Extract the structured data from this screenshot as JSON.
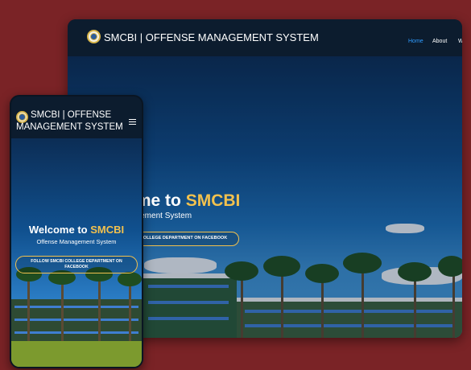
{
  "desktop": {
    "brand": "SMCBI | OFFENSE MANAGEMENT SYSTEM",
    "nav": [
      {
        "label": "Home",
        "active": true
      },
      {
        "label": "About",
        "active": false
      },
      {
        "label": "W",
        "active": false
      }
    ],
    "hero": {
      "welcome_prefix": "ome to",
      "welcome_highlight": "SMCBI",
      "subtitle": "agement System",
      "cta": "COLLEGE DEPARTMENT ON FACEBOOK"
    }
  },
  "phone": {
    "brand_line1": "SMCBI | OFFENSE",
    "brand_line2": "MANAGEMENT SYSTEM",
    "menu_icon": "hamburger-icon",
    "hero": {
      "welcome_prefix": "Welcome to",
      "welcome_highlight": "SMCBI",
      "subtitle": "Offense Management System",
      "cta_line1": "FOLLOW SMCBI COLLEGE DEPARTMENT ON",
      "cta_line2": "FACEBOOK"
    }
  },
  "colors": {
    "background": "#7a2326",
    "navbar": "#0c1c2e",
    "accent_gold": "#f2c14e",
    "active_link": "#2f9bff"
  }
}
